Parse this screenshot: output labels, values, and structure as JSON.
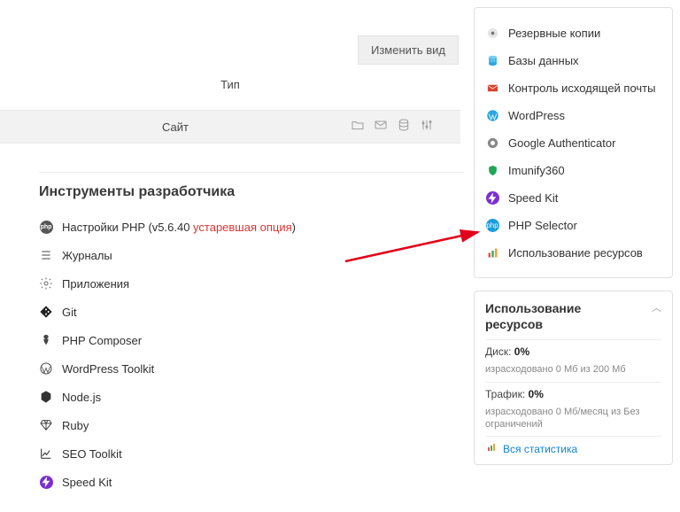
{
  "header": {
    "change_view_btn": "Изменить вид",
    "type_label": "Тип",
    "site_label": "Сайт"
  },
  "dev_tools": {
    "title": "Инструменты разработчика",
    "php_label_prefix": "Настройки PHP (v5.6.40 ",
    "php_deprecated": "устаревшая опция",
    "php_label_suffix": ")",
    "items": [
      {
        "name": "journals",
        "label": "Журналы"
      },
      {
        "name": "applications",
        "label": "Приложения"
      },
      {
        "name": "git",
        "label": "Git"
      },
      {
        "name": "composer",
        "label": "PHP Composer"
      },
      {
        "name": "wp-toolkit",
        "label": "WordPress Toolkit"
      },
      {
        "name": "nodejs",
        "label": "Node.js"
      },
      {
        "name": "ruby",
        "label": "Ruby"
      },
      {
        "name": "seo-toolkit",
        "label": "SEO Toolkit"
      },
      {
        "name": "speedkit",
        "label": "Speed Kit"
      }
    ]
  },
  "right_menu": {
    "items": [
      {
        "name": "backups",
        "label": "Резервные копии"
      },
      {
        "name": "databases",
        "label": "Базы данных"
      },
      {
        "name": "mail-control",
        "label": "Контроль исходящей почты"
      },
      {
        "name": "wordpress",
        "label": "WordPress"
      },
      {
        "name": "gauth",
        "label": "Google Authenticator"
      },
      {
        "name": "imunify",
        "label": "Imunify360"
      },
      {
        "name": "speedkit",
        "label": "Speed Kit"
      },
      {
        "name": "php-selector",
        "label": "PHP Selector"
      },
      {
        "name": "res-usage-link",
        "label": "Использование ресурсов"
      }
    ]
  },
  "usage": {
    "title_l1": "Использование",
    "title_l2": "ресурсов",
    "disk_label": "Диск:",
    "disk_value": "0%",
    "disk_sub": "израсходовано 0 Мб из 200 Мб",
    "traffic_label": "Трафик:",
    "traffic_value": "0%",
    "traffic_sub": "израсходовано 0 Мб/месяц из Без ограничений",
    "all_stats": "Вся статистика"
  }
}
